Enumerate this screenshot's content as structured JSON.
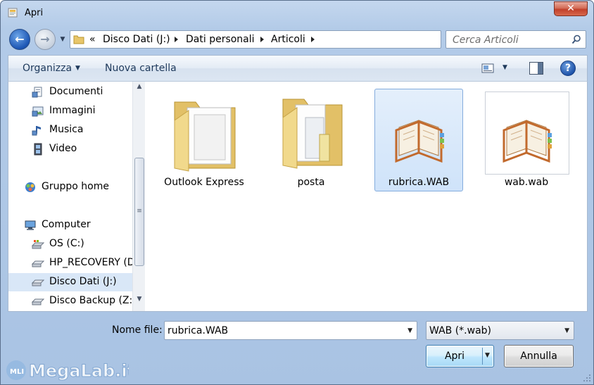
{
  "window": {
    "title": "Apri",
    "close_label": "✕"
  },
  "navigation": {
    "back_label": "←",
    "forward_label": "→",
    "address": {
      "prefix": "«",
      "parts": [
        "Disco Dati (J:)",
        "Dati personali",
        "Articoli"
      ]
    },
    "search_placeholder": "Cerca Articoli"
  },
  "toolbar": {
    "organize_label": "Organizza",
    "new_folder_label": "Nuova cartella",
    "help_label": "?"
  },
  "sidebar": {
    "items": [
      {
        "label": "Documenti",
        "icon": "documents-icon"
      },
      {
        "label": "Immagini",
        "icon": "pictures-icon"
      },
      {
        "label": "Musica",
        "icon": "music-icon"
      },
      {
        "label": "Video",
        "icon": "video-icon"
      },
      {
        "label": "Gruppo home",
        "icon": "homegroup-icon"
      },
      {
        "label": "Computer",
        "icon": "computer-icon"
      },
      {
        "label": "OS (C:)",
        "icon": "os-drive-icon"
      },
      {
        "label": "HP_RECOVERY (D",
        "icon": "drive-icon"
      },
      {
        "label": "Disco Dati (J:)",
        "icon": "drive-icon",
        "selected": true
      },
      {
        "label": "Disco Backup (Z:)",
        "icon": "drive-icon"
      }
    ]
  },
  "files": [
    {
      "name": "Outlook Express",
      "type": "folder"
    },
    {
      "name": "posta",
      "type": "folder"
    },
    {
      "name": "rubrica.WAB",
      "type": "wab",
      "selected": true
    },
    {
      "name": "wab.wab",
      "type": "wab"
    }
  ],
  "footer": {
    "filename_label": "Nome file:",
    "filename_value": "rubrica.WAB",
    "filter_value": "WAB (*.wab)",
    "open_label": "Apri",
    "cancel_label": "Annulla"
  },
  "watermark": {
    "text": "MegaLab.it"
  },
  "colors": {
    "selection": "#cfe3fa",
    "accent": "#1b55b4",
    "close": "#c1412b"
  }
}
